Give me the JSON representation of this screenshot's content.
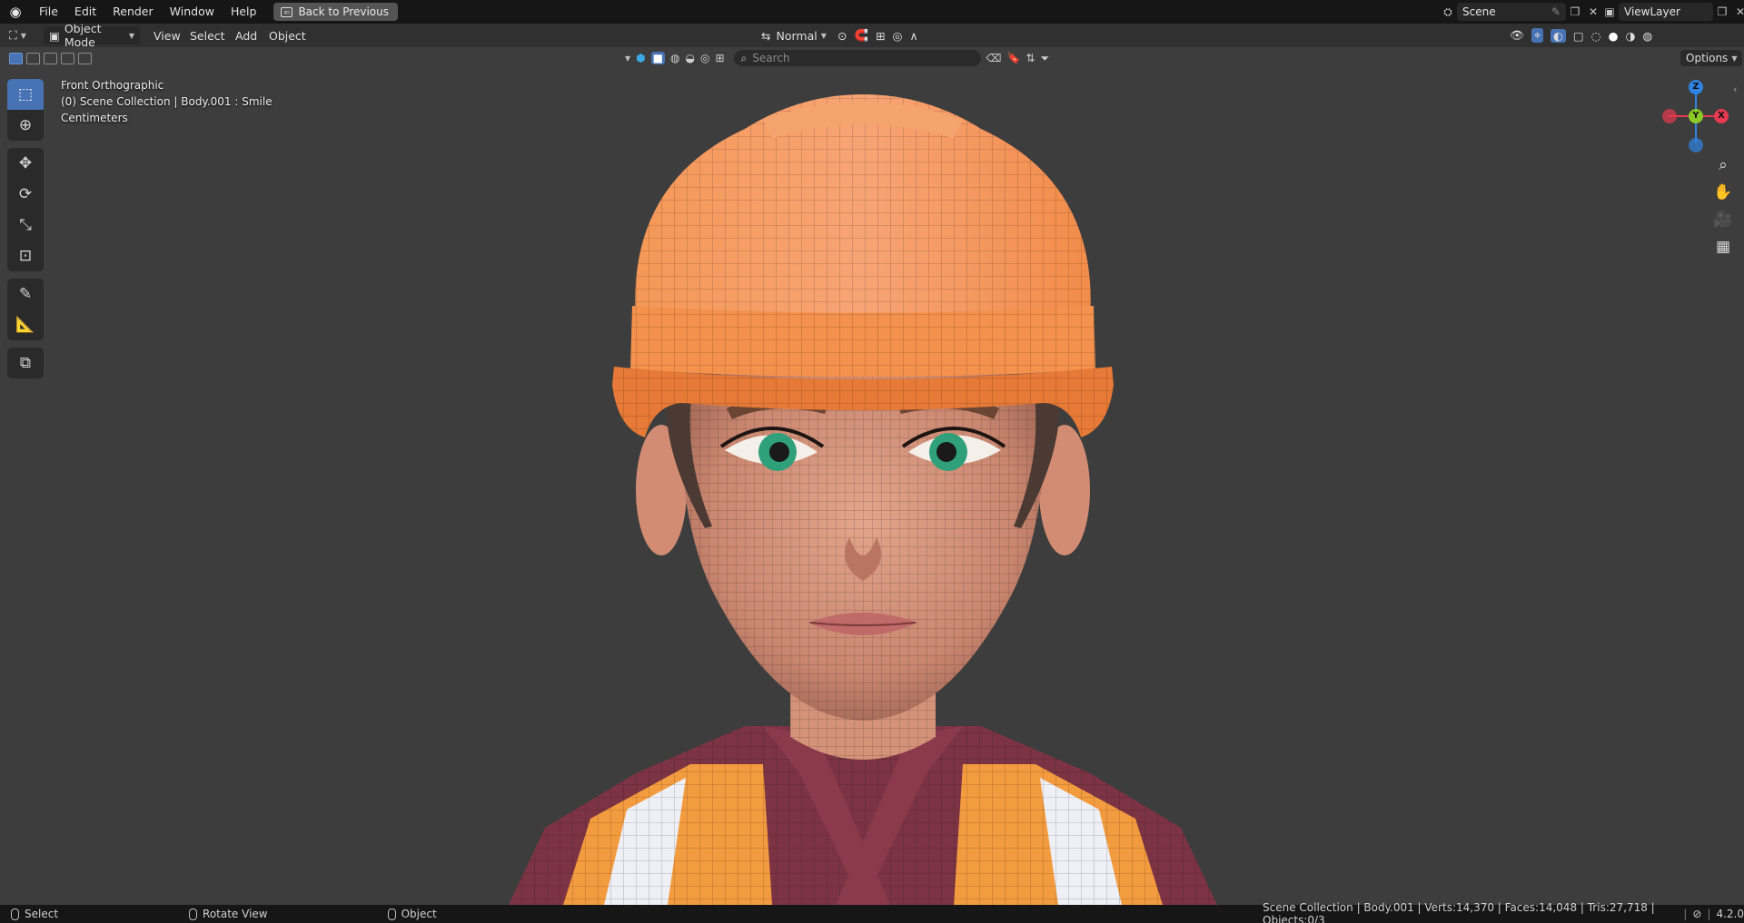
{
  "topbar": {
    "menus": [
      "File",
      "Edit",
      "Render",
      "Window",
      "Help"
    ],
    "back_button": "Back to Previous",
    "scene_name": "Scene",
    "view_layer_name": "ViewLayer"
  },
  "viewport_header": {
    "mode": "Object Mode",
    "menus": [
      "View",
      "Select",
      "Add",
      "Object"
    ],
    "orientation": "Normal",
    "search_placeholder": "Search",
    "options_label": "Options"
  },
  "overlay": {
    "view_name": "Front Orthographic",
    "collection_info": "(0) Scene Collection | Body.001 : Smile",
    "units": "Centimeters"
  },
  "gizmo": {
    "axes": {
      "z": "Z",
      "y": "Y",
      "x": "X"
    },
    "colors": {
      "x": "#e53a4f",
      "y": "#8ac926",
      "z": "#2f83e3",
      "neg_x": "#8f2a37",
      "neg_z": "#2d5b92"
    }
  },
  "toolbar_icons": [
    "select-box-icon",
    "cursor-icon",
    "move-icon",
    "rotate-icon",
    "scale-icon",
    "transform-icon",
    "annotate-icon",
    "measure-icon",
    "add-cube-icon"
  ],
  "statusbar": {
    "select": "Select",
    "rotate": "Rotate View",
    "object": "Object",
    "stats": "Scene Collection | Body.001 | Verts:14,370 | Faces:14,048 | Tris:27,718 | Objects:0/3",
    "version": "4.2.0"
  },
  "colors": {
    "accent": "#4772b3",
    "helmet": "#f08a4b",
    "skin": "#d9947c",
    "vest_orange": "#f29a3e",
    "shirt": "#7a3340",
    "eyes": "#2fa07a"
  }
}
